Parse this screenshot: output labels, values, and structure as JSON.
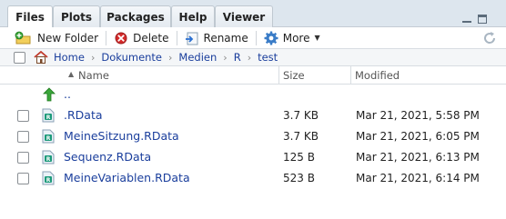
{
  "tabs": [
    {
      "label": "Files",
      "active": true
    },
    {
      "label": "Plots",
      "active": false
    },
    {
      "label": "Packages",
      "active": false
    },
    {
      "label": "Help",
      "active": false
    },
    {
      "label": "Viewer",
      "active": false
    }
  ],
  "toolbar": {
    "new_folder": "New Folder",
    "delete": "Delete",
    "rename": "Rename",
    "more": "More"
  },
  "breadcrumb": [
    "Home",
    "Dokumente",
    "Medien",
    "R",
    "test"
  ],
  "columns": {
    "name": "Name",
    "size": "Size",
    "modified": "Modified"
  },
  "parent_link": "..",
  "files": [
    {
      "name": ".RData",
      "size": "3.7 KB",
      "modified": "Mar 21, 2021, 5:58 PM"
    },
    {
      "name": "MeineSitzung.RData",
      "size": "3.7 KB",
      "modified": "Mar 21, 2021, 6:05 PM"
    },
    {
      "name": "Sequenz.RData",
      "size": "125 B",
      "modified": "Mar 21, 2021, 6:13 PM"
    },
    {
      "name": "MeineVariablen.RData",
      "size": "523 B",
      "modified": "Mar 21, 2021, 6:14 PM"
    }
  ],
  "colors": {
    "link": "#1a3e9c",
    "tabbar": "#dde6ee"
  }
}
